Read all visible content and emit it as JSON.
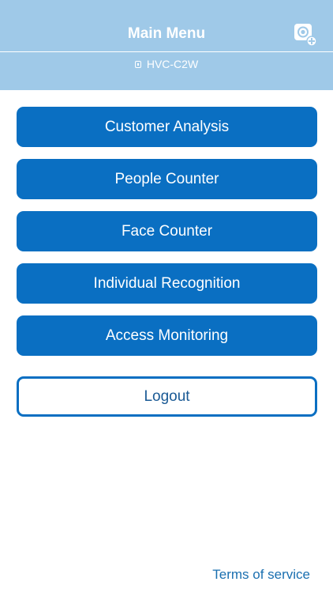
{
  "header": {
    "title": "Main Menu",
    "device_name": "HVC-C2W",
    "add_camera_icon": "camera-add-icon",
    "device_icon": "device-icon"
  },
  "menu": {
    "items": [
      {
        "label": "Customer Analysis"
      },
      {
        "label": "People Counter"
      },
      {
        "label": "Face Counter"
      },
      {
        "label": "Individual Recognition"
      },
      {
        "label": "Access Monitoring"
      }
    ],
    "logout_label": "Logout"
  },
  "footer": {
    "terms_label": "Terms of service"
  },
  "colors": {
    "header_bg": "#9fc9e8",
    "button_bg": "#0a6fc2",
    "button_text": "#ffffff",
    "logout_border": "#0a6fc2",
    "link": "#1a6fb0"
  }
}
